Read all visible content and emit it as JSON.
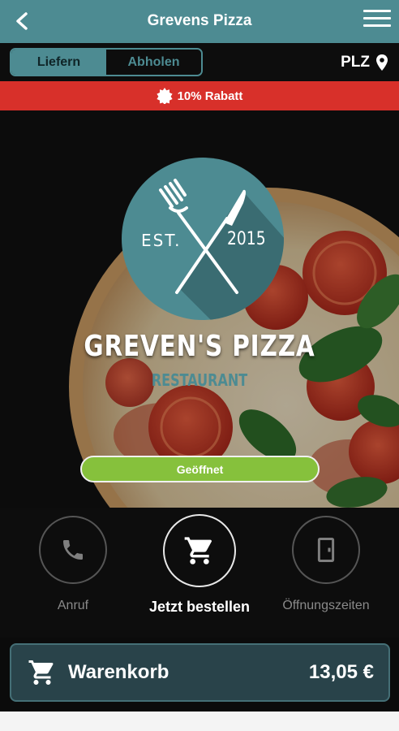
{
  "header": {
    "title": "Grevens Pizza",
    "back_icon": "chevron-left-icon",
    "menu_icon": "hamburger-menu-icon"
  },
  "mode_toggle": {
    "options": [
      "Liefern",
      "Abholen"
    ],
    "selected": "Liefern"
  },
  "location": {
    "label": "PLZ",
    "icon": "map-pin-icon"
  },
  "promo": {
    "text": "10% Rabatt",
    "icon": "badge-icon"
  },
  "hero": {
    "logo_text_left": "EST.",
    "logo_text_right": "2015",
    "brand_name": "GREVEN'S PIZZA",
    "brand_subtitle": "RESTAURANT",
    "status_button": "Geöffnet"
  },
  "actions": [
    {
      "label": "Anruf",
      "icon": "phone-icon"
    },
    {
      "label": "Jetzt bestellen",
      "icon": "cart-icon"
    },
    {
      "label": "Öffnungszeiten",
      "icon": "door-icon"
    }
  ],
  "cart": {
    "label": "Warenkorb",
    "total": "13,05 €",
    "icon": "cart-icon"
  },
  "colors": {
    "primary": "#4d8b92",
    "promo": "#d8302a",
    "open": "#86c13c",
    "cart_bg": "#29434a",
    "background": "#0b0b0b"
  }
}
